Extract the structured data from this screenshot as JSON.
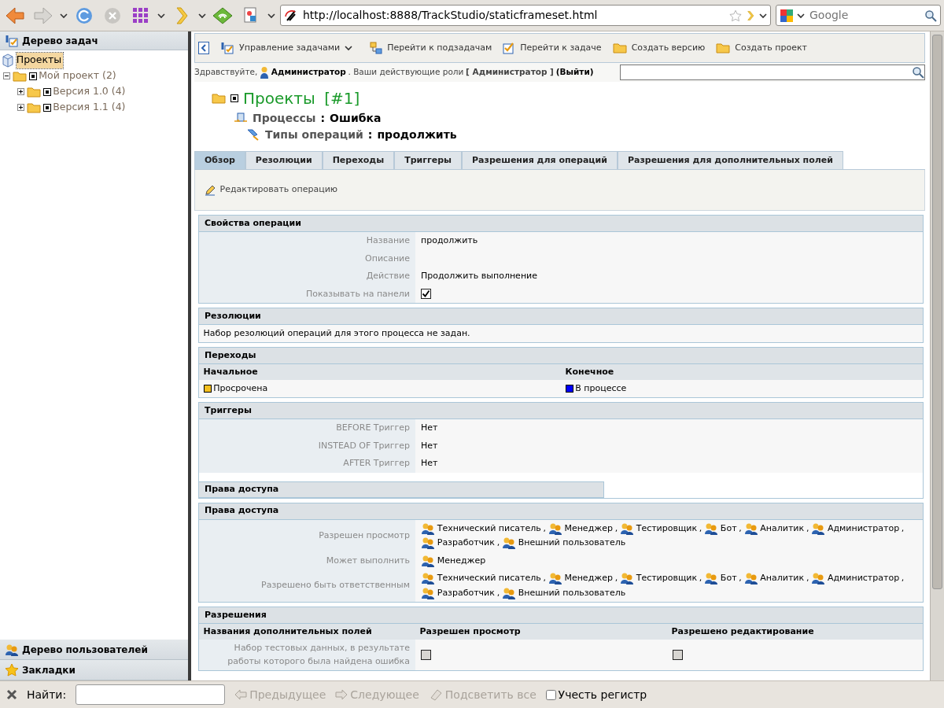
{
  "browser": {
    "url": "http://localhost:8888/TrackStudio/staticframeset.html",
    "search": {
      "placeholder": "Google"
    }
  },
  "sidebar": {
    "title": "Дерево задач",
    "tree": [
      {
        "label": "Проекты",
        "selected": true,
        "children": [
          {
            "label": "Мой проект (2)",
            "selected": false,
            "expanded": true,
            "children": [
              {
                "label": "Версия 1.0 (4)",
                "selected": false,
                "expanded": false
              },
              {
                "label": "Версия 1.1 (4)",
                "selected": false,
                "expanded": false
              }
            ]
          }
        ]
      }
    ],
    "bottom_panels": [
      "Дерево пользователей",
      "Закладки"
    ]
  },
  "toolbar": [
    {
      "label": "Управление задачами",
      "kind": "menu"
    },
    {
      "label": "Перейти к подзадачам",
      "kind": "action"
    },
    {
      "label": "Перейти к задаче",
      "kind": "action"
    },
    {
      "label": "Создать версию",
      "kind": "action"
    },
    {
      "label": "Создать проект",
      "kind": "action"
    }
  ],
  "greeting": {
    "prefix": "Здравствуйте,",
    "user": "Администратор",
    "middle": ". Ваши действующие роли",
    "roles": "[ Администратор ]",
    "logout": "(**Выйти**)"
  },
  "breadcrumb": [
    {
      "label": "Проекты",
      "value": "[#1]"
    },
    {
      "label": "Процессы",
      "separator": ":",
      "value": "Ошибка"
    },
    {
      "label": "Типы операций",
      "separator": ":",
      "value": "продолжить"
    }
  ],
  "tabs": [
    {
      "label": "Обзор",
      "selected": true
    },
    {
      "label": "Резолюции",
      "selected": false
    },
    {
      "label": "Переходы",
      "selected": false
    },
    {
      "label": "Триггеры",
      "selected": false
    },
    {
      "label": "Разрешения для операций",
      "selected": false
    },
    {
      "label": "Разрешения для дополнительных полей",
      "selected": false
    }
  ],
  "edit_link": "Редактировать операцию",
  "sections": [
    {
      "kind": "properties",
      "title": "Свойства операции",
      "rows": [
        {
          "label": "Название",
          "kind": "text",
          "value": "продолжить"
        },
        {
          "label": "Описание",
          "kind": "text"
        },
        {
          "label": "Действие",
          "kind": "text",
          "value": "Продолжить выполнение"
        },
        {
          "label": "Показывать на панели",
          "kind": "checkbox",
          "checked": true
        }
      ]
    },
    {
      "kind": "message",
      "title": "Резолюции",
      "text": "Набор резолюций операций для этого процесса не задан."
    },
    {
      "kind": "transitions",
      "title": "Переходы",
      "columns": [
        "Начальное",
        "Конечное"
      ],
      "rows": [
        [
          {
            "text": "Просрочена",
            "color": "#f5bf1e"
          },
          {
            "text": "В процессе",
            "color": "#0000ff"
          }
        ]
      ]
    },
    {
      "kind": "properties",
      "title": "Триггеры",
      "rows": [
        {
          "label": "BEFORE Триггер",
          "kind": "text",
          "value": "Нет"
        },
        {
          "label": "INSTEAD OF Триггер",
          "kind": "text",
          "value": "Нет"
        },
        {
          "label": "AFTER Триггер",
          "kind": "text",
          "value": "Нет"
        }
      ],
      "trailing_header": "Права доступа"
    },
    {
      "kind": "access",
      "title": "Права доступа",
      "separator": ",",
      "rows": [
        {
          "label": "Разрешен просмотр",
          "roles": [
            "Технический писатель",
            "Менеджер",
            "Тестировщик",
            "Бот",
            "Аналитик",
            "Администратор",
            "Разработчик",
            "Внешний пользователь"
          ]
        },
        {
          "label": "Может выполнить",
          "roles": [
            "Менеджер"
          ]
        },
        {
          "label": "Разрешено быть ответственным",
          "roles": [
            "Технический писатель",
            "Менеджер",
            "Тестировщик",
            "Бот",
            "Аналитик",
            "Администратор",
            "Разработчик",
            "Внешний пользователь"
          ]
        }
      ]
    },
    {
      "kind": "permissions",
      "title": "Разрешения",
      "columns": [
        "Названия дополнительных полей",
        "Разрешен просмотр",
        "Разрешено редактирование"
      ],
      "rows": [
        {
          "label": "Набор тестовых данных, в результате работы которого была найдена ошибка",
          "view": false,
          "edit": false
        }
      ]
    }
  ],
  "find_bar": {
    "label": "Найти:",
    "buttons": [
      {
        "label": "Предыдущее",
        "disabled": true
      },
      {
        "label": "Следующее",
        "disabled": true
      },
      {
        "label": "Подсветить все",
        "disabled": true
      }
    ],
    "match_case": {
      "label": "Учесть регистр",
      "checked": false
    }
  }
}
